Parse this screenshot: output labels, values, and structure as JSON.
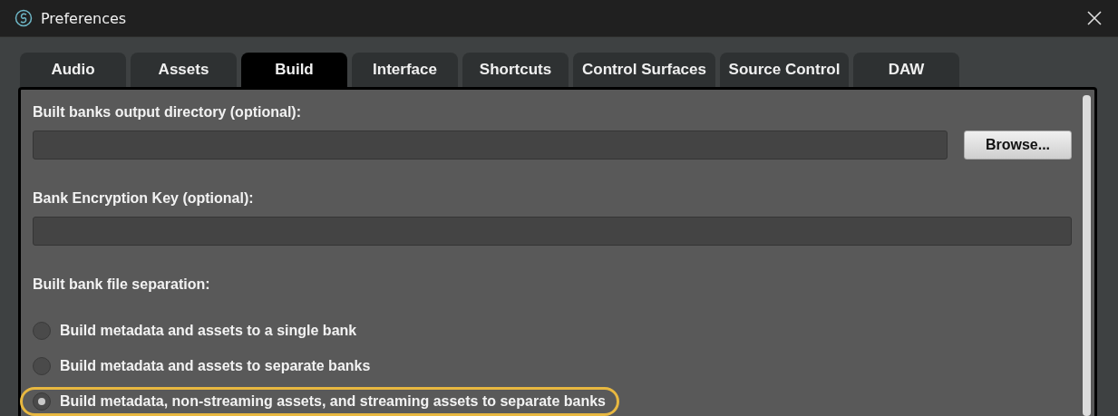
{
  "window": {
    "title": "Preferences"
  },
  "tabs": [
    {
      "label": "Audio",
      "selected": false
    },
    {
      "label": "Assets",
      "selected": false
    },
    {
      "label": "Build",
      "selected": true
    },
    {
      "label": "Interface",
      "selected": false
    },
    {
      "label": "Shortcuts",
      "selected": false
    },
    {
      "label": "Control Surfaces",
      "selected": false
    },
    {
      "label": "Source Control",
      "selected": false
    },
    {
      "label": "DAW",
      "selected": false
    }
  ],
  "output_directory": {
    "label": "Built banks output directory (optional):",
    "button": "Browse..."
  },
  "encryption_key": {
    "label": "Bank Encryption Key (optional):"
  },
  "file_separation": {
    "label": "Built bank file separation:",
    "options": [
      {
        "label": "Build metadata and assets to a single bank",
        "selected": false,
        "highlighted": false
      },
      {
        "label": "Build metadata and assets to separate banks",
        "selected": false,
        "highlighted": false
      },
      {
        "label": "Build metadata, non-streaming assets, and streaming assets to separate banks",
        "selected": true,
        "highlighted": true
      }
    ]
  }
}
